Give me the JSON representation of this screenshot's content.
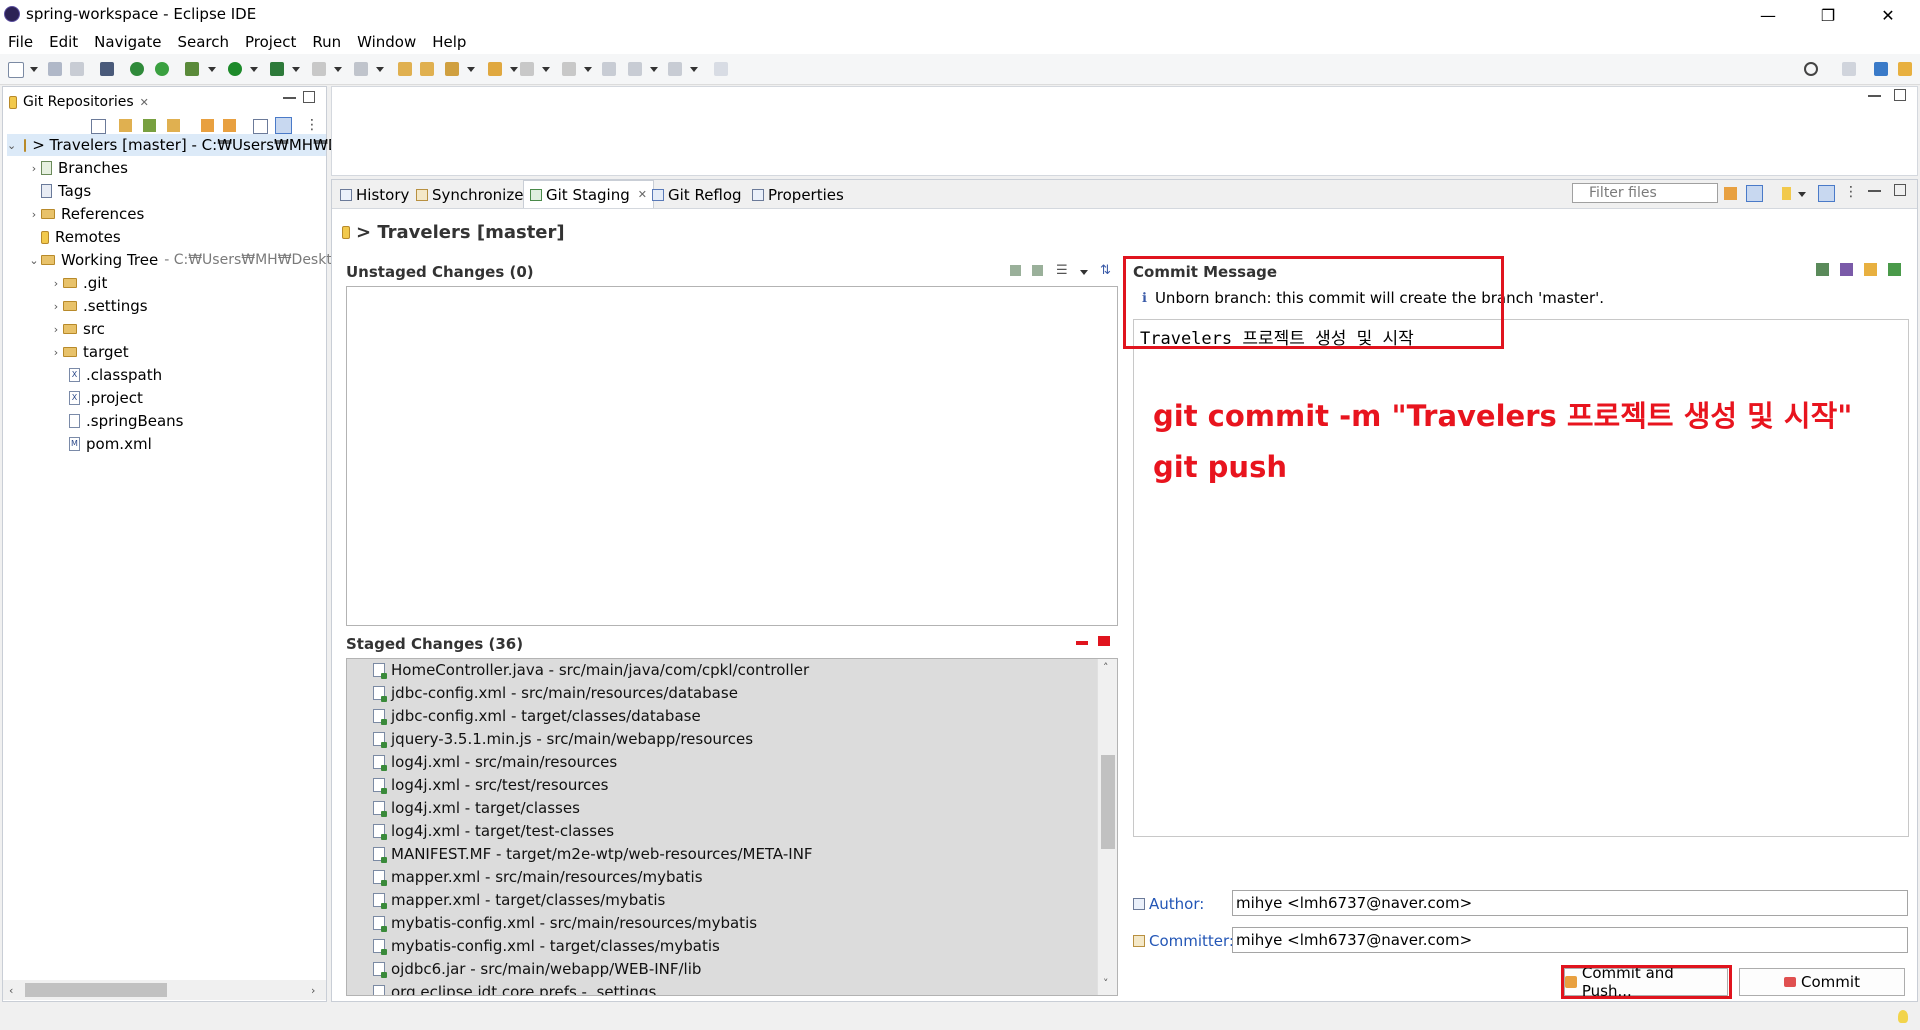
{
  "window": {
    "title": "spring-workspace - Eclipse IDE",
    "minimize": "—",
    "restore": "❐",
    "close": "✕"
  },
  "menu": [
    "File",
    "Edit",
    "Navigate",
    "Search",
    "Project",
    "Run",
    "Window",
    "Help"
  ],
  "left_panel": {
    "tab_label": "Git Repositories",
    "tab_close": "✕",
    "repo_row": "> Travelers [master] - C:₩Users₩MH₩De",
    "tree": {
      "branches": "Branches",
      "tags": "Tags",
      "references": "References",
      "remotes": "Remotes",
      "working_tree": "Working Tree",
      "working_tree_path": "- C:₩Users₩MH₩Deskto",
      "git": ".git",
      "settings": ".settings",
      "src": "src",
      "target": "target",
      "classpath": ".classpath",
      "project": ".project",
      "springbeans": ".springBeans",
      "pom": "pom.xml"
    }
  },
  "tabs": {
    "history": "History",
    "synchronize": "Synchronize",
    "git_staging": "Git Staging",
    "git_reflog": "Git Reflog",
    "properties": "Properties",
    "filter_placeholder": "Filter files"
  },
  "staging": {
    "header": "> Travelers [master]",
    "unstaged_title": "Unstaged Changes (0)",
    "staged_title": "Staged Changes (36)",
    "staged_files": [
      "HomeController.java - src/main/java/com/cpkl/controller",
      "jdbc-config.xml - src/main/resources/database",
      "jdbc-config.xml - target/classes/database",
      "jquery-3.5.1.min.js - src/main/webapp/resources",
      "log4j.xml - src/main/resources",
      "log4j.xml - src/test/resources",
      "log4j.xml - target/classes",
      "log4j.xml - target/test-classes",
      "MANIFEST.MF - target/m2e-wtp/web-resources/META-INF",
      "mapper.xml - src/main/resources/mybatis",
      "mapper.xml - target/classes/mybatis",
      "mybatis-config.xml - src/main/resources/mybatis",
      "mybatis-config.xml - target/classes/mybatis",
      "ojdbc6.jar - src/main/webapp/WEB-INF/lib",
      "org.eclipse.jdt.core.prefs - .settings"
    ],
    "commit_message_title": "Commit Message",
    "info_text": "Unborn branch: this commit will create the branch 'master'.",
    "message_text": "Travelers 프로젝트 생성 및 시작",
    "annotation_line1": "git commit -m \"Travelers 프로젝트 생성 및 시작\"",
    "annotation_line2": "git push",
    "author_label": "Author:",
    "author_value": "mihye <lmh6737@naver.com>",
    "committer_label": "Committer:",
    "committer_value": "mihye <lmh6737@naver.com>",
    "commit_push_button": "Commit and Push...",
    "commit_button": "Commit"
  },
  "colors": {
    "annotation_red": "#e8141e",
    "link_blue": "#2356b6"
  }
}
